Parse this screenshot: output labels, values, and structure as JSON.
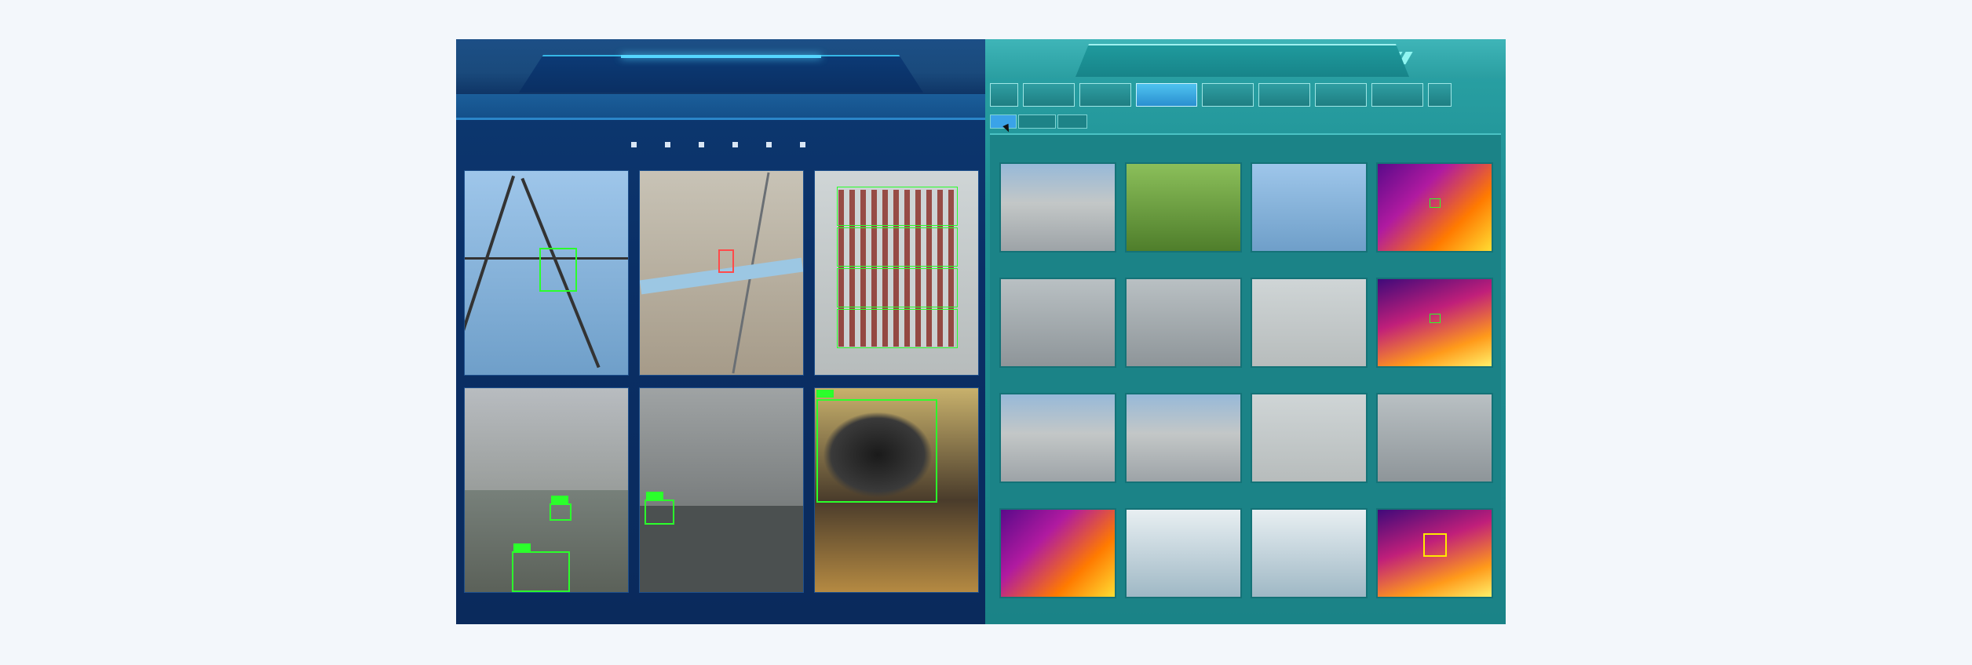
{
  "left_panel": {
    "title": "",
    "legend": [
      {
        "label": ""
      },
      {
        "label": ""
      },
      {
        "label": ""
      },
      {
        "label": ""
      },
      {
        "label": ""
      },
      {
        "label": ""
      }
    ],
    "tiles": [
      {
        "caption": ""
      },
      {
        "caption": ""
      },
      {
        "caption": ""
      },
      {
        "caption": ""
      },
      {
        "caption": ""
      },
      {
        "caption": ""
      }
    ]
  },
  "right_panel": {
    "title": "",
    "nav_items": [
      "",
      "",
      "",
      "",
      "",
      "",
      "",
      "",
      ""
    ],
    "subtabs": [
      "",
      "",
      ""
    ],
    "status_text": ""
  },
  "colors": {
    "left_bg": "#0a2f66",
    "right_bg": "#1f8f93",
    "detection_box": "#2bff2b",
    "nav_active": "#2a8fd0"
  }
}
